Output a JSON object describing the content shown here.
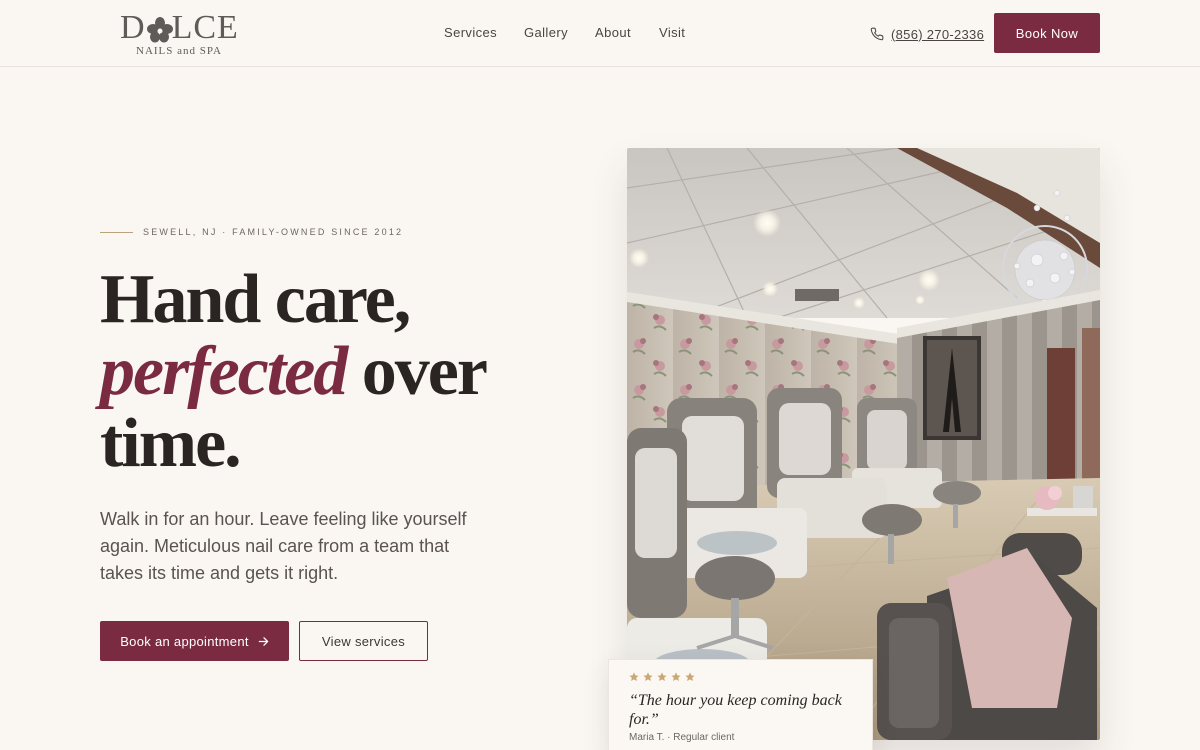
{
  "brand": {
    "wordmark": "DOLCE",
    "tagline": "NAILS and SPA"
  },
  "nav": {
    "links": [
      {
        "label": "Services"
      },
      {
        "label": "Gallery"
      },
      {
        "label": "About"
      },
      {
        "label": "Visit"
      }
    ],
    "phone": "(856) 270-2336",
    "phone_icon": "phone-icon",
    "book_label": "Book Now"
  },
  "hero": {
    "eyebrow": "SEWELL, NJ · FAMILY-OWNED SINCE 2012",
    "headline": {
      "line1": "Hand care,",
      "accent": "perfected",
      "line2_rest": " over",
      "line3": "time."
    },
    "lead": "Walk in for an hour. Leave feeling like yourself again. Meticulous nail care from a team that takes its time and gets it right.",
    "primary_cta": "Book an appointment",
    "primary_cta_icon": "arrow-right-icon",
    "secondary_cta": "View services",
    "photo_description_icon": "salon-photo"
  },
  "review": {
    "rating": 5,
    "quote": "“The hour you keep coming back for.”",
    "author": "Maria T. · Regular client"
  },
  "colors": {
    "accent": "#7a2b42",
    "background": "#faf7f3",
    "gold": "#c9a876",
    "text": "#2a2523"
  }
}
